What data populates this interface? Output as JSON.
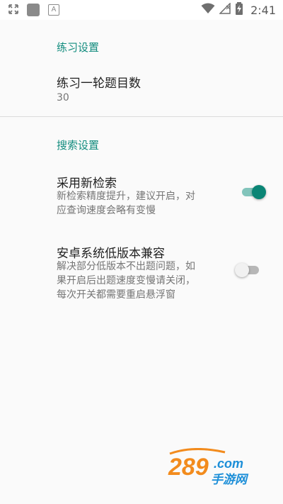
{
  "status_bar": {
    "time": "2:41",
    "left_icons": [
      "fullscreen-icon",
      "app-notification-icon",
      "a-notification-icon"
    ],
    "right_icons": [
      "wifi-icon",
      "signal-icon",
      "battery-charging-icon"
    ]
  },
  "sections": [
    {
      "title": "练习设置",
      "items": [
        {
          "title": "练习一轮题目数",
          "summary": "30"
        }
      ]
    },
    {
      "title": "搜索设置",
      "items": [
        {
          "title": "采用新检索",
          "summary_lines": [
            "新检索精度提升，建议开启，对",
            "应查询速度会略有变慢"
          ],
          "enabled": true
        },
        {
          "title": "安卓系统低版本兼容",
          "summary_lines": [
            "解决部分低版本不出题问题，如",
            "果开启后出题速度变慢请关闭，",
            "每次开关都需要重启悬浮窗"
          ],
          "enabled": false
        }
      ]
    }
  ],
  "watermark": {
    "domain": "289.com",
    "subtitle": "手游网"
  },
  "colors": {
    "accent": "#128c7e",
    "switch_on_thumb": "#0a8575",
    "switch_on_track": "#82c4bb",
    "switch_off_thumb": "#f1f1f1",
    "switch_off_track": "#b7b7b7",
    "background": "#fafafa",
    "watermark_orange": "#f28b1d",
    "watermark_blue": "#1d8fd8"
  }
}
